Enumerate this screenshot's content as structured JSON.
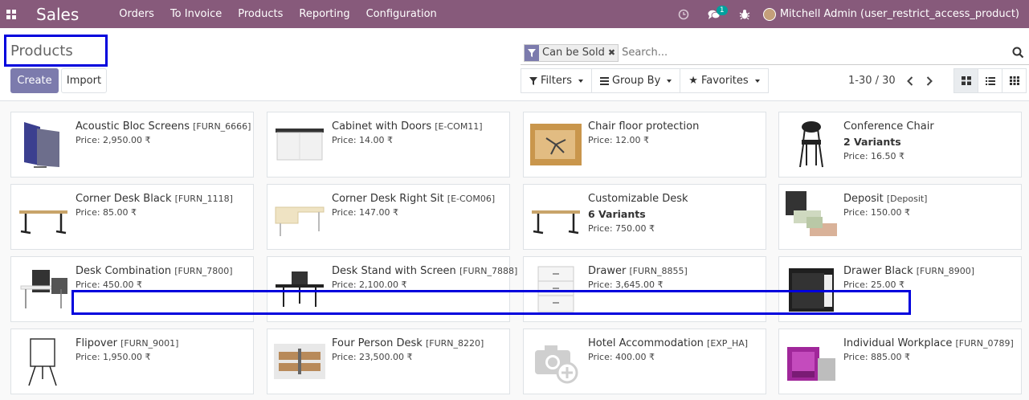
{
  "navbar": {
    "brand": "Sales",
    "menu": [
      "Orders",
      "To Invoice",
      "Products",
      "Reporting",
      "Configuration"
    ],
    "chat_badge": "1",
    "user": "Mitchell Admin (user_restrict_access_product)"
  },
  "control": {
    "breadcrumb": "Products",
    "create_label": "Create",
    "import_label": "Import",
    "facet_label": "Can be Sold",
    "search_placeholder": "Search...",
    "filters_label": "Filters",
    "groupby_label": "Group By",
    "favorites_label": "Favorites",
    "pager": "1-30 / 30"
  },
  "products": [
    {
      "name": "Acoustic Bloc Screens",
      "code": "[FURN_6666]",
      "variants": "",
      "price": "Price: 2,950.00 ₹",
      "icon": "acoustic-screen-icon"
    },
    {
      "name": "Cabinet with Doors",
      "code": "[E-COM11]",
      "variants": "",
      "price": "Price: 14.00 ₹",
      "icon": "cabinet-icon"
    },
    {
      "name": "Chair floor protection",
      "code": "",
      "variants": "",
      "price": "Price: 12.00 ₹",
      "icon": "floor-mat-icon"
    },
    {
      "name": "Conference Chair",
      "code": "",
      "variants": "2 Variants",
      "price": "Price: 16.50 ₹",
      "icon": "chair-icon"
    },
    {
      "name": "Corner Desk Black",
      "code": "[FURN_1118]",
      "variants": "",
      "price": "Price: 85.00 ₹",
      "icon": "desk-icon"
    },
    {
      "name": "Corner Desk Right Sit",
      "code": "[E-COM06]",
      "variants": "",
      "price": "Price: 147.00 ₹",
      "icon": "corner-desk-icon"
    },
    {
      "name": "Customizable Desk",
      "code": "",
      "variants": "6 Variants",
      "price": "Price: 750.00 ₹",
      "icon": "desk-icon"
    },
    {
      "name": "Deposit",
      "code": "[Deposit]",
      "variants": "",
      "price": "Price: 150.00 ₹",
      "icon": "money-icon"
    },
    {
      "name": "Desk Combination",
      "code": "[FURN_7800]",
      "variants": "",
      "price": "Price: 450.00 ₹",
      "icon": "desk-combo-icon"
    },
    {
      "name": "Desk Stand with Screen",
      "code": "[FURN_7888]",
      "variants": "",
      "price": "Price: 2,100.00 ₹",
      "icon": "desk-stand-icon"
    },
    {
      "name": "Drawer",
      "code": "[FURN_8855]",
      "variants": "",
      "price": "Price: 3,645.00 ₹",
      "icon": "drawer-icon"
    },
    {
      "name": "Drawer Black",
      "code": "[FURN_8900]",
      "variants": "",
      "price": "Price: 25.00 ₹",
      "icon": "drawer-black-icon"
    },
    {
      "name": "Flipover",
      "code": "[FURN_9001]",
      "variants": "",
      "price": "Price: 1,950.00 ₹",
      "icon": "flipchart-icon"
    },
    {
      "name": "Four Person Desk",
      "code": "[FURN_8220]",
      "variants": "",
      "price": "Price: 23,500.00 ₹",
      "icon": "office-desks-icon"
    },
    {
      "name": "Hotel Accommodation",
      "code": "[EXP_HA]",
      "variants": "",
      "price": "Price: 400.00 ₹",
      "icon": "camera-placeholder-icon"
    },
    {
      "name": "Individual Workplace",
      "code": "[FURN_0789]",
      "variants": "",
      "price": "Price: 885.00 ₹",
      "icon": "workplace-pod-icon"
    }
  ],
  "colors": {
    "navbar": "#875a7b",
    "primary": "#7c7bad",
    "highlight": "#0000dd"
  }
}
